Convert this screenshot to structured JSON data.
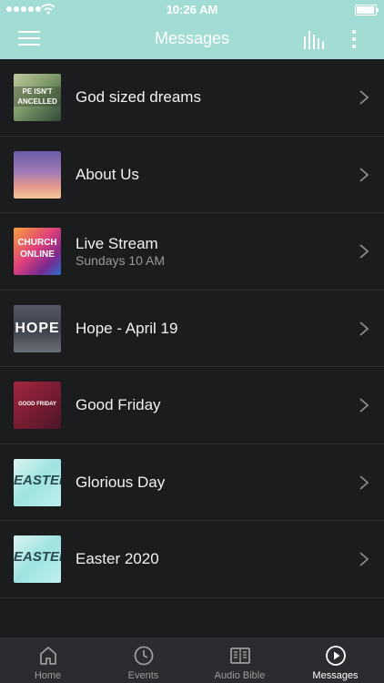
{
  "status": {
    "time": "10:26 AM",
    "battery_level": 0.95
  },
  "header": {
    "title": "Messages"
  },
  "items": [
    {
      "title": "God sized dreams",
      "thumb_text": "PE ISN'T ANCELLED",
      "thumb_icon": "god-sized-dreams-thumbnail"
    },
    {
      "title": "About Us",
      "thumb_icon": "sunset-thumbnail"
    },
    {
      "title": "Live Stream",
      "subtitle": "Sundays 10 AM",
      "thumb_text": "CHURCH ONLINE",
      "thumb_icon": "church-online-thumbnail"
    },
    {
      "title": "Hope - April 19",
      "thumb_text": "HOPE",
      "thumb_icon": "hope-thumbnail"
    },
    {
      "title": "Good Friday",
      "thumb_text": "GOOD FRIDAY",
      "thumb_icon": "good-friday-thumbnail"
    },
    {
      "title": "Glorious Day",
      "thumb_text": "EASTER",
      "thumb_icon": "easter-thumbnail"
    },
    {
      "title": "Easter 2020",
      "thumb_text": "EASTER",
      "thumb_icon": "easter-thumbnail"
    }
  ],
  "tabs": [
    {
      "label": "Home",
      "icon": "home-icon"
    },
    {
      "label": "Events",
      "icon": "clock-icon"
    },
    {
      "label": "Audio Bible",
      "icon": "book-icon"
    },
    {
      "label": "Messages",
      "icon": "play-circle-icon",
      "active": true
    }
  ],
  "colors": {
    "accent": "#a3dcd5",
    "background": "#1b1c1e",
    "tabbar": "#2b2c2f"
  }
}
